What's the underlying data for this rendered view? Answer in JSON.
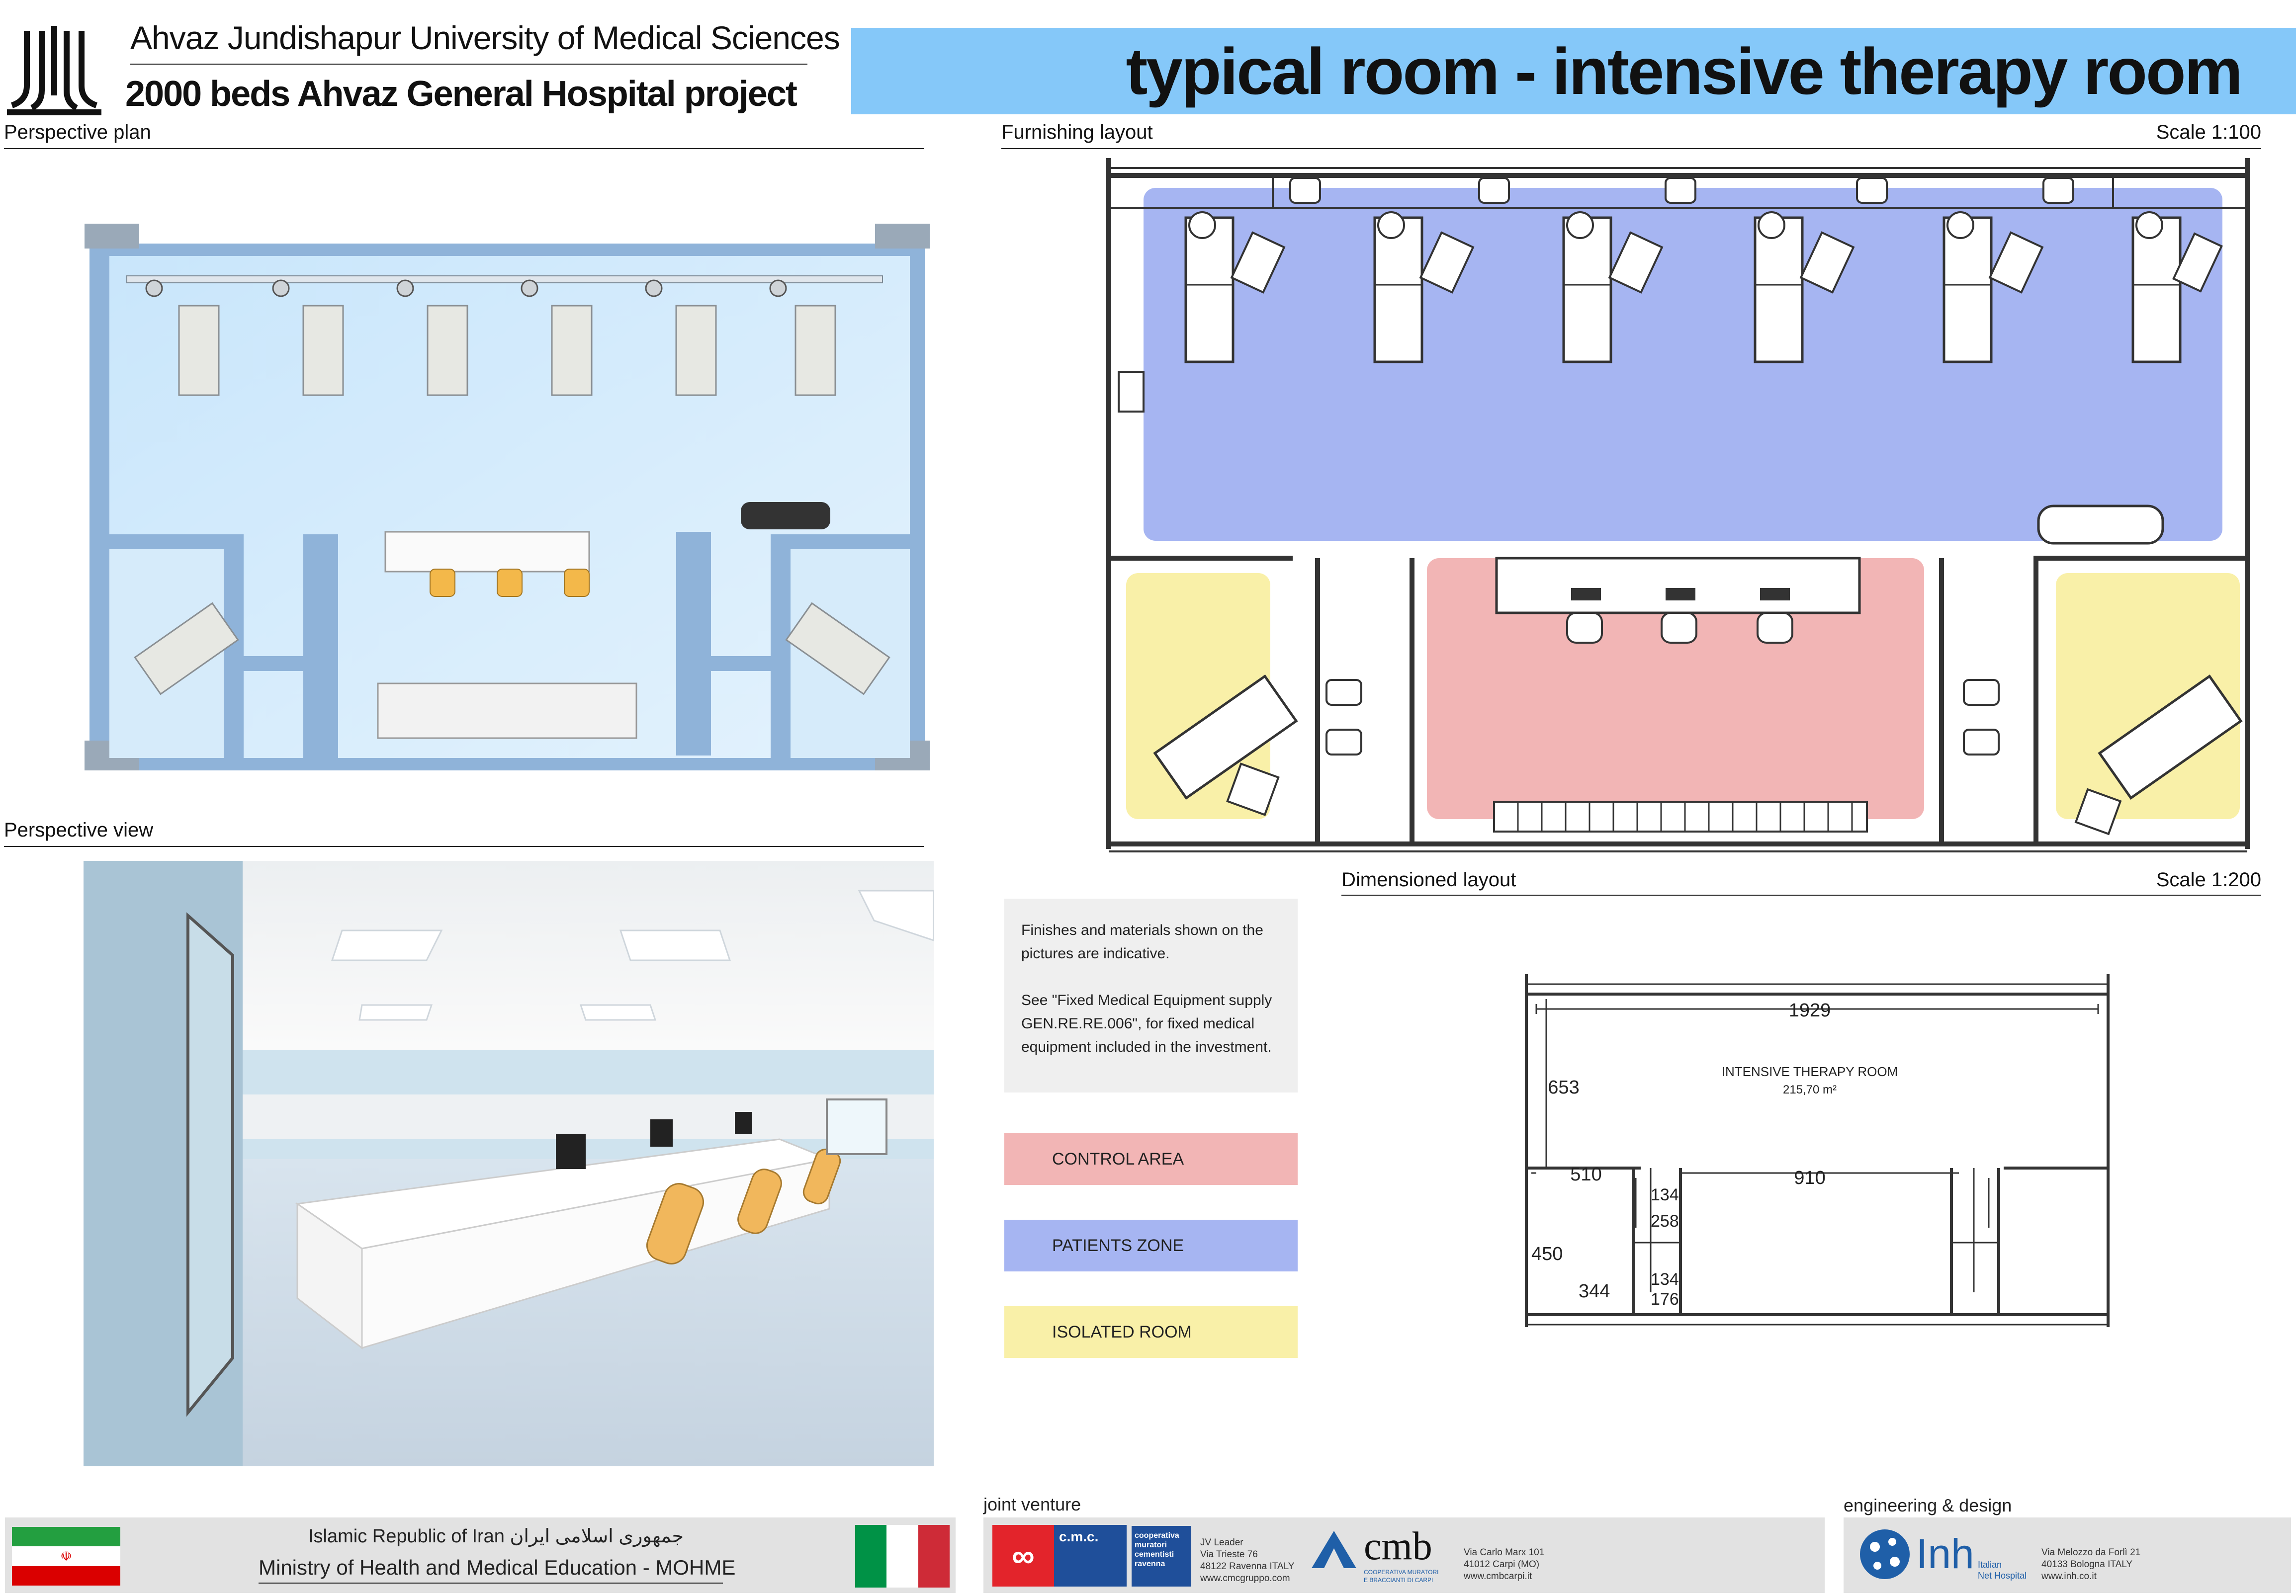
{
  "header": {
    "university": "Ahvaz Jundishapur University of Medical Sciences",
    "project": "2000 beds Ahvaz General Hospital project",
    "room_title": "typical room  - intensive therapy room",
    "title_bg": "#85c8f9"
  },
  "sections": {
    "perspective_plan": "Perspective plan",
    "perspective_view": "Perspective view",
    "furnishing_layout": "Furnishing layout",
    "furnishing_scale": "Scale 1:100",
    "dimensioned_layout": "Dimensioned layout",
    "dimensioned_scale": "Scale 1:200"
  },
  "notes": {
    "line1": "Finishes and materials  shown on the",
    "line2": "pictures are indicative.",
    "line3": "See \"Fixed Medical Equipment supply",
    "line4": "GEN.RE.RE.006\", for  fixed medical",
    "line5": "equipment included in the investment."
  },
  "legend": [
    {
      "label": "CONTROL AREA",
      "color": "#f2b5b5"
    },
    {
      "label": "PATIENTS ZONE",
      "color": "#a6b5f2"
    },
    {
      "label": "ISOLATED ROOM",
      "color": "#f9f0a8"
    }
  ],
  "dimensions": {
    "room_name": "INTENSIVE THERAPY ROOM",
    "room_area": "215,70  m²",
    "d1929": "1929",
    "d653": "653",
    "d510": "510",
    "d910": "910",
    "d134a": "134",
    "d258": "258",
    "d450": "450",
    "d344": "344",
    "d134b": "134",
    "d176": "176"
  },
  "footer": {
    "iran_line": "Islamic Republic of Iran جمهوری اسلامی ایران",
    "ministry": "Ministry of Health and Medical Education - MOHME",
    "joint_venture": "joint venture",
    "cmc_logo": "c.m.c.",
    "cmc_desc1": "cooperativa",
    "cmc_desc2": "muratori",
    "cmc_desc3": "cementisti",
    "cmc_desc4": "ravenna",
    "cmc_addr1": "JV Leader",
    "cmc_addr2": "Via Trieste 76",
    "cmc_addr3": "48122 Ravenna ITALY",
    "cmc_addr4": "www.cmcgruppo.com",
    "cmb_logo": "cmb",
    "cmb_sub1": "COOPERATIVA MURATORI",
    "cmb_sub2": "E BRACCIANTI DI CARPI",
    "cmb_addr1": "Via Carlo Marx 101",
    "cmb_addr2": "41012 Carpi (MO)",
    "cmb_addr3": "www.cmbcarpi.it",
    "eng_design": "engineering & design",
    "inh_logo": "Inh",
    "inh_sub1": "Italian",
    "inh_sub2": "Net Hospital",
    "inh_addr1": "Via Melozzo da Forlì 21",
    "inh_addr2": "40133 Bologna ITALY",
    "inh_addr3": "www.inh.co.it"
  }
}
